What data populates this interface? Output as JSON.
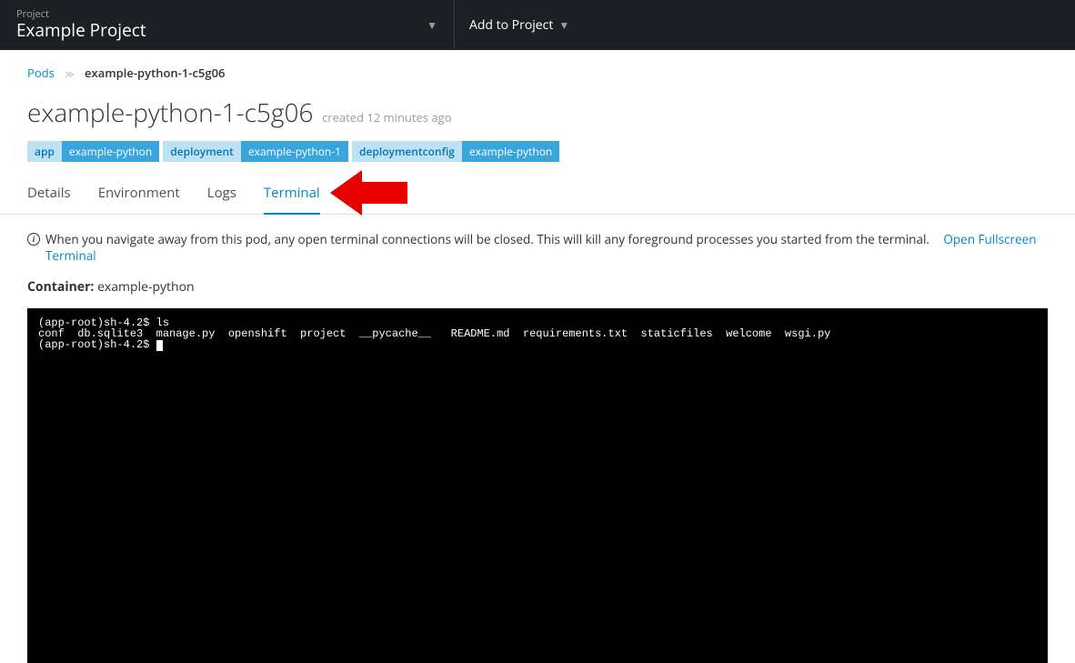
{
  "header": {
    "project_label": "Project",
    "project_name": "Example Project",
    "add_to_project": "Add to Project"
  },
  "breadcrumb": {
    "root": "Pods",
    "current": "example-python-1-c5g06"
  },
  "page": {
    "title": "example-python-1-c5g06",
    "created": "created 12 minutes ago"
  },
  "labels": [
    {
      "key": "app",
      "val": "example-python"
    },
    {
      "key": "deployment",
      "val": "example-python-1"
    },
    {
      "key": "deploymentconfig",
      "val": "example-python"
    }
  ],
  "tabs": [
    "Details",
    "Environment",
    "Logs",
    "Terminal"
  ],
  "active_tab": "Terminal",
  "notice": "When you navigate away from this pod, any open terminal connections will be closed. This will kill any foreground processes you started from the terminal.",
  "fullscreen_link": "Open Fullscreen Terminal",
  "container_label": "Container:",
  "container_name": "example-python",
  "terminal": {
    "line1": "(app-root)sh-4.2$ ls",
    "line2": "conf  db.sqlite3  manage.py  openshift  project  __pycache__   README.md  requirements.txt  staticfiles  welcome  wsgi.py",
    "line3": "(app-root)sh-4.2$ "
  }
}
